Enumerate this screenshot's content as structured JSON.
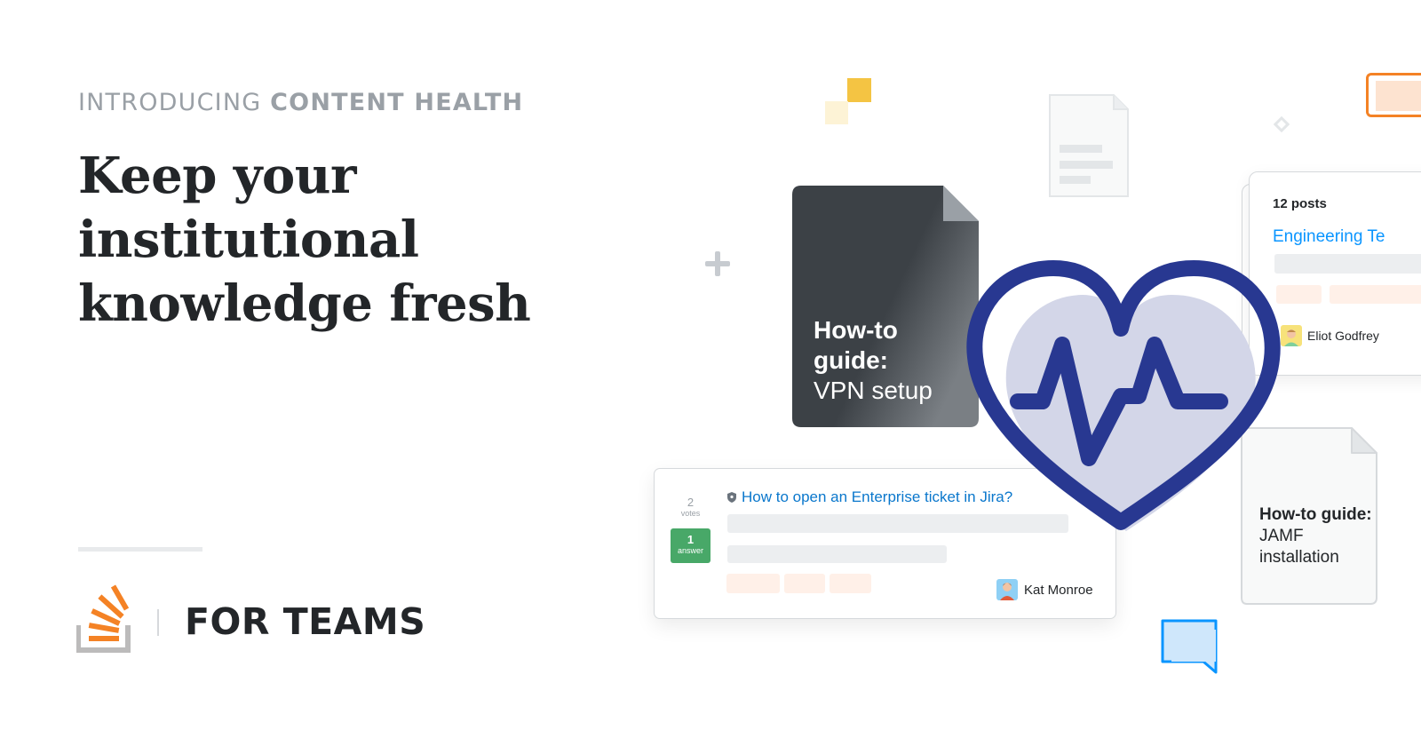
{
  "intro": {
    "prefix": "INTRODUCING",
    "strong": "CONTENT HEALTH"
  },
  "headline": {
    "line1": "Keep your institutional",
    "line2": "knowledge fresh"
  },
  "brand": {
    "label": "FOR TEAMS",
    "logo": "stack-overflow-logo",
    "accent": "#f48225",
    "logo_gray": "#bcbbbb"
  },
  "dark_doc": {
    "title": "How-to guide:",
    "subtitle": "VPN setup",
    "color": "#3c4146"
  },
  "question_card": {
    "votes": "2",
    "votes_label": "votes",
    "answers": "1",
    "answers_label": "answer",
    "title": "How to open an Enterprise ticket in Jira?",
    "author": "Kat Monroe",
    "link_color": "#0a77cc",
    "answer_color": "#48a868"
  },
  "collection_card": {
    "posts": "12 posts",
    "title": "Engineering Te",
    "author": "Eliot Godfrey"
  },
  "jamf_doc": {
    "title": "How-to guide:",
    "subtitle": "JAMF installation"
  },
  "heart": {
    "icon": "heartbeat-icon",
    "stroke": "#283891",
    "fill": "#d3d6e8"
  },
  "decorations": [
    "plus-icon",
    "diamond-icon",
    "chat-bubble-icon",
    "document-icon",
    "yellow-squares"
  ]
}
